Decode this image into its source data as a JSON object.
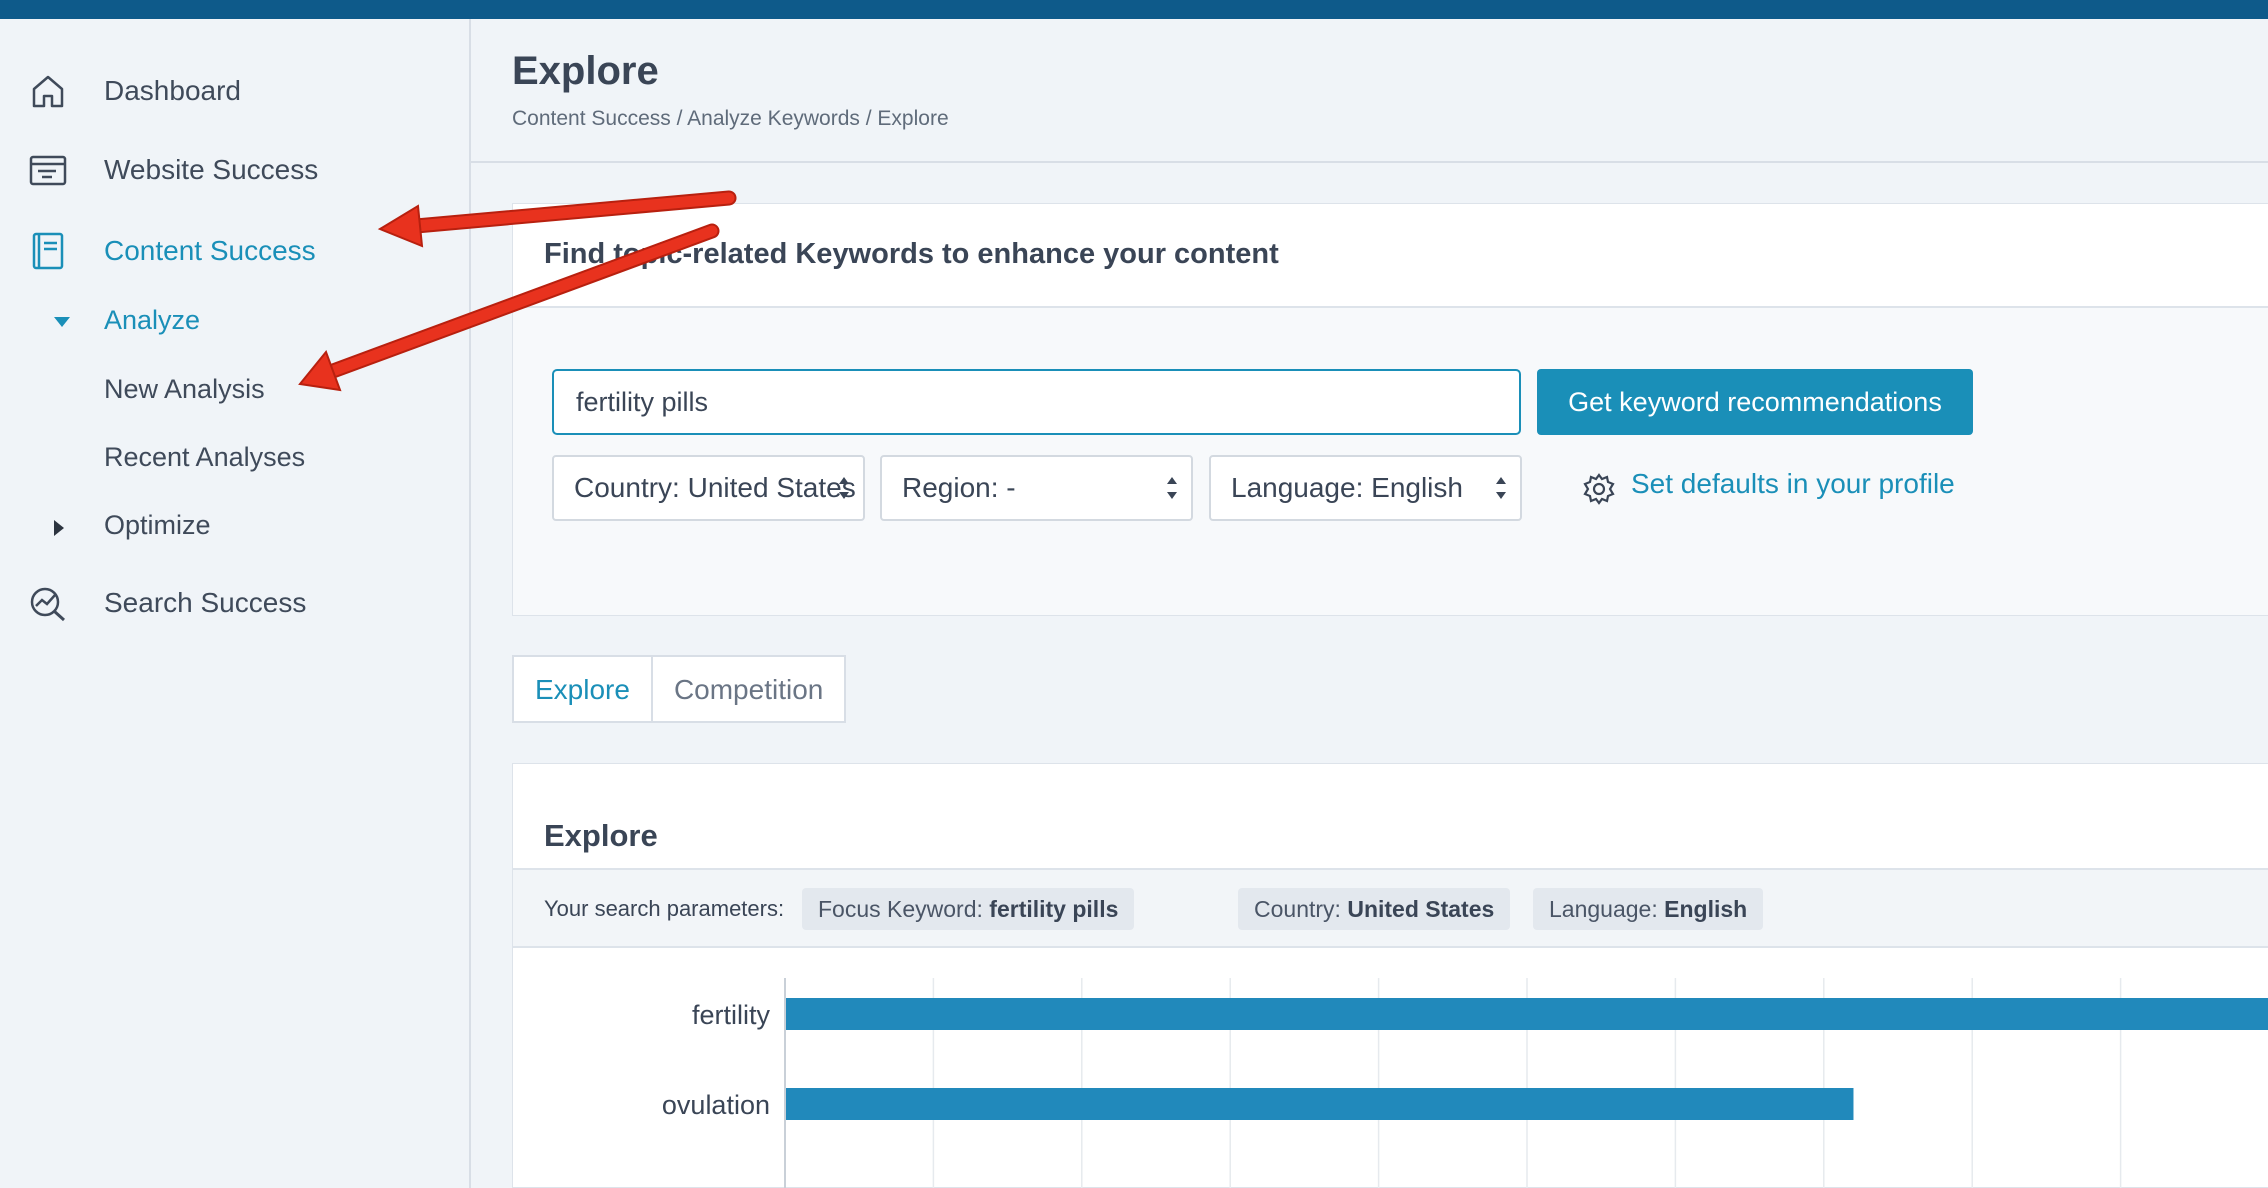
{
  "sidebar": {
    "items": [
      {
        "label": "Dashboard",
        "icon": "home-icon"
      },
      {
        "label": "Website Success",
        "icon": "browser-window-icon"
      },
      {
        "label": "Content Success",
        "icon": "document-icon",
        "active": true
      },
      {
        "label": "Search Success",
        "icon": "search-chart-icon"
      }
    ],
    "sub": {
      "analyze": "Analyze",
      "new_analysis": "New Analysis",
      "recent_analyses": "Recent Analyses",
      "optimize": "Optimize"
    }
  },
  "header": {
    "title": "Explore",
    "breadcrumb": [
      "Content Success",
      "Analyze Keywords",
      "Explore"
    ],
    "separator": "/"
  },
  "search_card": {
    "title": "Find topic-related Keywords to enhance your content",
    "keyword_value": "fertility pills",
    "button_label": "Get keyword recommendations",
    "country_select": "Country: United States",
    "region_select": "Region: -",
    "language_select": "Language: English",
    "defaults_link": "Set defaults in your profile"
  },
  "tabs": [
    {
      "label": "Explore",
      "active": true
    },
    {
      "label": "Competition",
      "active": false
    }
  ],
  "explore_card": {
    "title": "Explore",
    "params_label": "Your search parameters:",
    "chips": [
      {
        "key": "Focus Keyword:",
        "value": "fertility pills"
      },
      {
        "key": "Country:",
        "value": "United States"
      },
      {
        "key": "Language:",
        "value": "English"
      }
    ]
  },
  "chart_data": {
    "type": "bar",
    "orientation": "horizontal",
    "categories": [
      "fertility",
      "ovulation"
    ],
    "values": [
      100,
      72
    ],
    "xlim": [
      0,
      100
    ],
    "grid": true,
    "bar_color": "#2189bb"
  },
  "colors": {
    "accent": "#1a8fb8",
    "topbar": "#0e5a8a",
    "annotation_arrow": "#e8321e"
  }
}
